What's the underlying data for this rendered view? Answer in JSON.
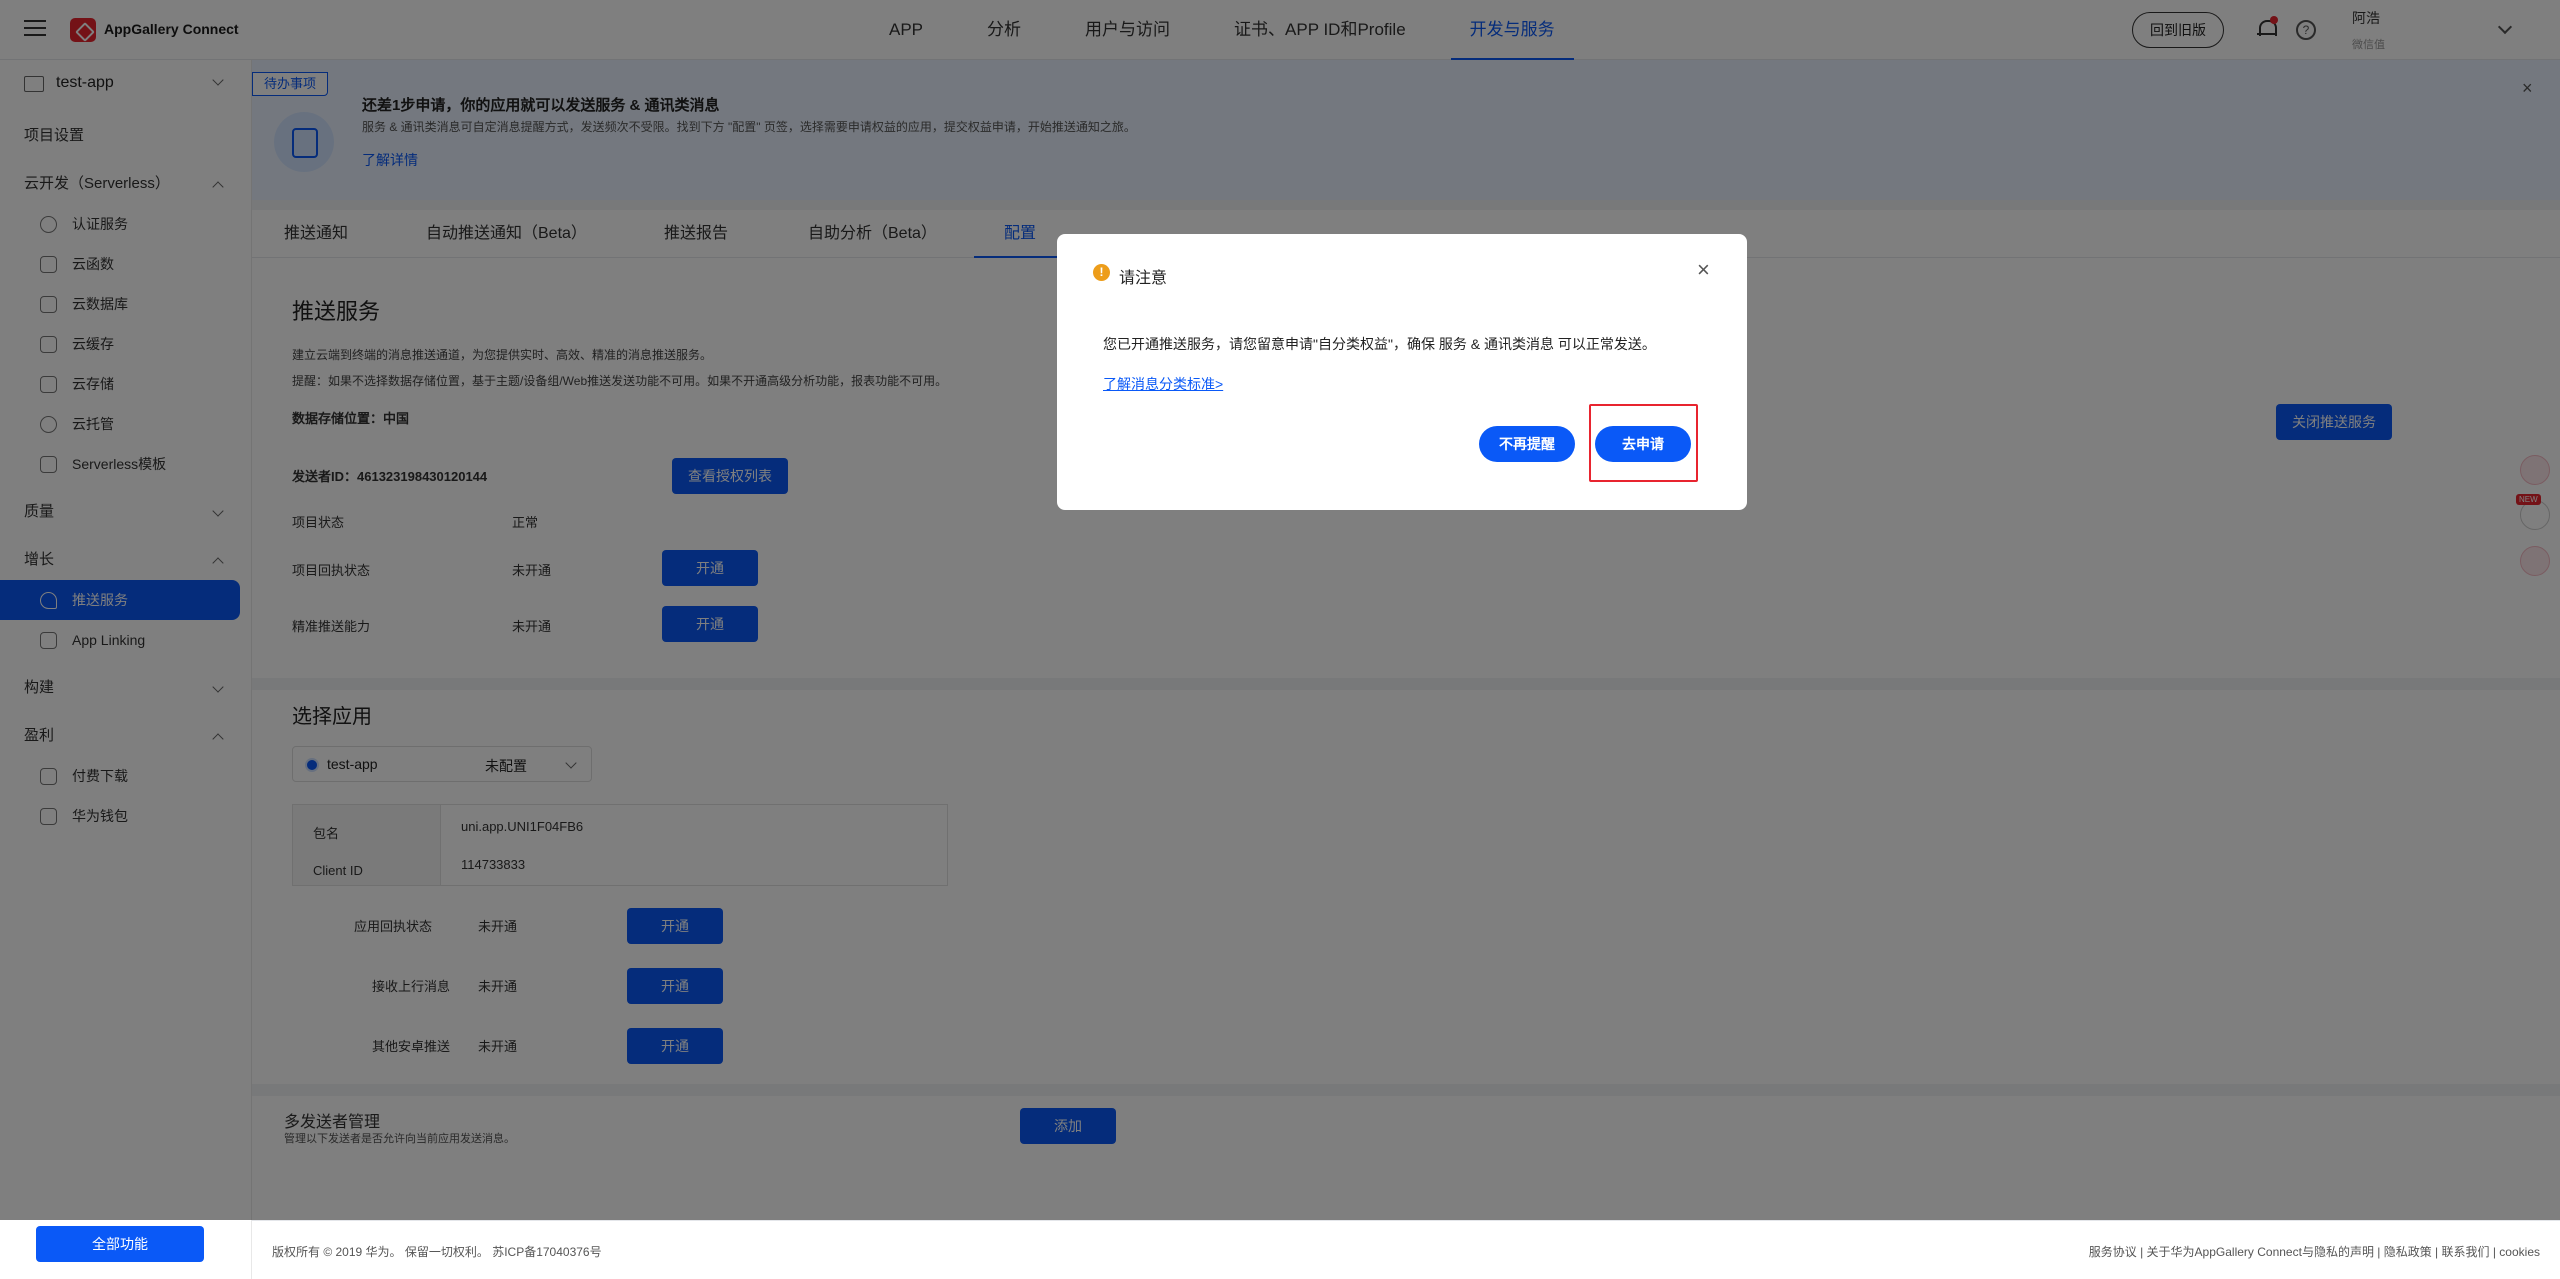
{
  "header": {
    "brand": "AppGallery Connect",
    "nav": [
      "APP",
      "分析",
      "用户与访问",
      "证书、APP ID和Profile",
      "开发与服务"
    ],
    "active_nav": "开发与服务",
    "old_version": "回到旧版",
    "user_name": "阿浩",
    "user_sub": "微信值"
  },
  "sidebar": {
    "app": "test-app",
    "project_settings": "项目设置",
    "serverless_group": "云开发（Serverless）",
    "serverless_items": [
      "认证服务",
      "云函数",
      "云数据库",
      "云缓存",
      "云存储",
      "云托管",
      "Serverless模板"
    ],
    "quality": "质量",
    "growth": "增长",
    "growth_items": [
      "推送服务",
      "App Linking"
    ],
    "build": "构建",
    "earn": "盈利",
    "earn_items": [
      "付费下载",
      "华为钱包"
    ],
    "all_features": "全部功能"
  },
  "notice": {
    "badge": "待办事项",
    "title": "还差1步申请，你的应用就可以发送服务 & 通讯类消息",
    "desc": "服务 & 通讯类消息可自定消息提醒方式，发送频次不受限。找到下方 \"配置\" 页签，选择需要申请权益的应用，提交权益申请，开始推送通知之旅。",
    "link": "了解详情",
    "close": "×"
  },
  "tabs": [
    "推送通知",
    "自动推送通知（Beta）",
    "推送报告",
    "自助分析（Beta）",
    "配置"
  ],
  "push": {
    "title": "推送服务",
    "desc1": "建立云端到终端的消息推送通道，为您提供实时、高效、精准的消息推送服务。",
    "desc2": "提醒：如果不选择数据存储位置，基于主题/设备组/Web推送发送功能不可用。如果不开通高级分析功能，报表功能不可用。",
    "storage": "数据存储位置：中国",
    "close_service": "关闭推送服务",
    "sender_id": "发送者ID：461323198430120144",
    "view_auth": "查看授权列表",
    "project_status_label": "项目状态",
    "project_status_value": "正常",
    "callback_label": "项目回执状态",
    "callback_value": "未开通",
    "precise_label": "精准推送能力",
    "precise_value": "未开通",
    "open": "开通"
  },
  "app_section": {
    "title": "选择应用",
    "app_name": "test-app",
    "app_state": "未配置",
    "package_label": "包名",
    "package_value": "uni.app.UNI1F04FB6",
    "client_label": "Client ID",
    "client_value": "114733833",
    "rows": [
      {
        "label": "应用回执状态",
        "value": "未开通"
      },
      {
        "label": "接收上行消息",
        "value": "未开通"
      },
      {
        "label": "其他安卓推送",
        "value": "未开通"
      }
    ],
    "open": "开通"
  },
  "multi_sender": {
    "title": "多发送者管理",
    "desc": "管理以下发送者是否允许向当前应用发送消息。",
    "add": "添加"
  },
  "footer": {
    "left": "版权所有 © 2019 华为。 保留一切权利。 苏ICP备17040376号",
    "right": "服务协议 | 关于华为AppGallery Connect与隐私的声明 | 隐私政策 | 联系我们 | cookies"
  },
  "floating_new": "NEW",
  "dialog": {
    "title": "请注意",
    "warn": "!",
    "text": "您已开通推送服务，请您留意申请\"自分类权益\"，确保 服务 & 通讯类消息 可以正常发送。",
    "link": "了解消息分类标准>",
    "btn_no": "不再提醒",
    "btn_apply": "去申请",
    "close": "×"
  }
}
